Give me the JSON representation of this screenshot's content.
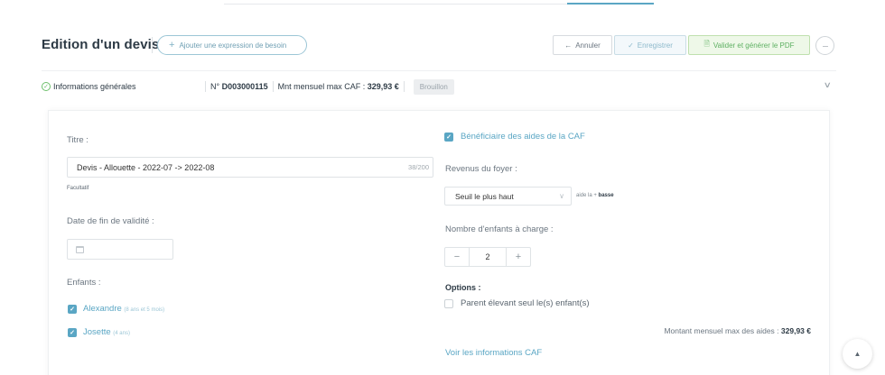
{
  "header": {
    "title": "Edition d'un devis",
    "add_need_label": "Ajouter une expression de besoin",
    "cancel_label": "Annuler",
    "save_label": "Enregistrer",
    "validate_label": "Valider et générer le PDF",
    "more_label": "···"
  },
  "info_bar": {
    "general_label": "Informations générales",
    "number_text": "N° D003000115",
    "max_label": "Mnt mensuel max CAF : ",
    "max_value": "329,93 €",
    "status": "Brouillon"
  },
  "form": {
    "title_label": "Titre :",
    "title_value": "Devis - Allouette - 2022-07 -> 2022-08",
    "title_counter": "38/200",
    "title_hint": "Facultatif",
    "validity_label": "Date de fin de validité :",
    "validity_value": "",
    "children_label": "Enfants :",
    "children": [
      {
        "name": "Alexandre",
        "age": "(8 ans et 5 mois)",
        "checked": true
      },
      {
        "name": "Josette",
        "age": "(4 ans)",
        "checked": true
      }
    ]
  },
  "caf": {
    "beneficiary_label": "Bénéficiaire des aides de la CAF",
    "beneficiary_checked": true,
    "income_label": "Revenus du foyer :",
    "income_selected": "Seuil le plus haut",
    "aid_note_prefix": "aide la + ",
    "aid_note_bold": "basse",
    "children_count_label": "Nombre d'enfants à charge :",
    "children_count": "2",
    "options_label": "Options :",
    "single_parent_label": "Parent élevant seul le(s) enfant(s)",
    "single_parent_checked": false,
    "total_label": "Montant mensuel max des aides : ",
    "total_value": "329,93 €",
    "info_link": "Voir les informations CAF"
  },
  "colors": {
    "accent": "#5aa6c4",
    "success": "#5eb062",
    "heading": "#2d3a45"
  }
}
